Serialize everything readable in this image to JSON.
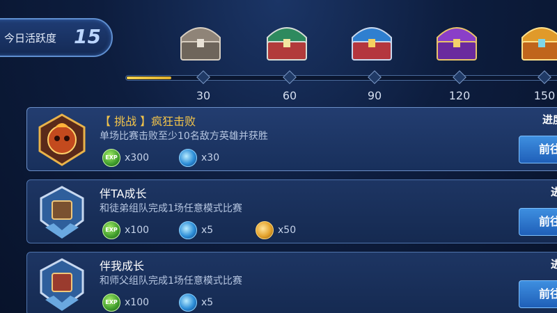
{
  "activity": {
    "label": "今日活跃度",
    "value": "15",
    "progress_fraction": 0.1
  },
  "milestones": [
    {
      "value": "30",
      "chest": "bronze-chest-icon",
      "color": "#b0a79b"
    },
    {
      "value": "60",
      "chest": "green-chest-icon",
      "color": "#3a9a6a"
    },
    {
      "value": "90",
      "chest": "blue-chest-icon",
      "color": "#3f8fd8"
    },
    {
      "value": "120",
      "chest": "purple-chest-icon",
      "color": "#8a3fc8"
    },
    {
      "value": "150",
      "chest": "gold-chest-icon",
      "color": "#e09a2a"
    }
  ],
  "tasks": [
    {
      "title": "【 挑战 】疯狂击败",
      "title_color": "gold",
      "desc": "单场比赛击败至少10名敌方英雄并获胜",
      "progress": "进度",
      "button": "前往",
      "emblem": "fire-skull-emblem-icon",
      "rewards": [
        {
          "icon": "exp-icon",
          "label": "EXP",
          "count": "x300"
        },
        {
          "icon": "crystal-icon",
          "count": "x30"
        }
      ]
    },
    {
      "title": "伴TA成长",
      "title_color": "white",
      "desc": "和徒弟组队完成1场任意模式比赛",
      "progress": "进",
      "button": "前往",
      "emblem": "blue-shield-emblem-icon",
      "rewards": [
        {
          "icon": "exp-icon",
          "label": "EXP",
          "count": "x100"
        },
        {
          "icon": "crystal-icon",
          "count": "x5"
        },
        {
          "icon": "coin-icon",
          "count": "x50"
        }
      ]
    },
    {
      "title": "伴我成长",
      "title_color": "white",
      "desc": "和师父组队完成1场任意模式比赛",
      "progress": "进",
      "button": "前往",
      "emblem": "red-shield-emblem-icon",
      "rewards": [
        {
          "icon": "exp-icon",
          "label": "EXP",
          "count": "x100"
        },
        {
          "icon": "crystal-icon",
          "count": "x5"
        }
      ]
    }
  ]
}
